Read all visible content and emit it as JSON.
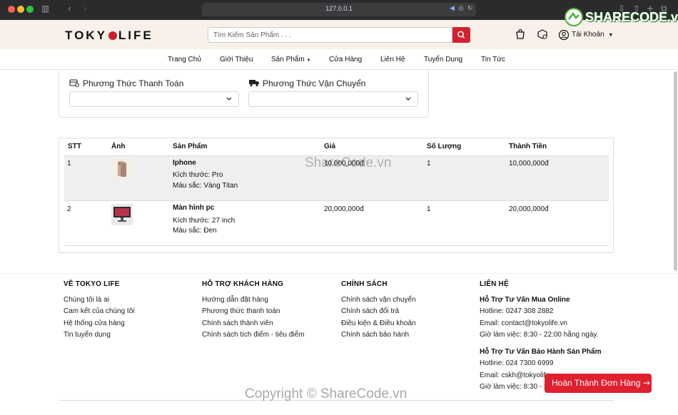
{
  "browser": {
    "url": "127.0.0.1"
  },
  "header": {
    "logo_left": "TOKY",
    "logo_right": "LIFE",
    "search_placeholder": "Tìm Kiếm Sản Phẩm . . .",
    "account_label": "Tài Khoản"
  },
  "nav": [
    "Trang Chủ",
    "Giới Thiệu",
    "Sản Phẩm",
    "Cửa Hàng",
    "Liên Hệ",
    "Tuyển Dụng",
    "Tin Tức"
  ],
  "checkout": {
    "payment_title": "Phương Thức Thanh Toán",
    "shipping_title": "Phương Thức Vận Chuyển"
  },
  "table": {
    "headers": [
      "STT",
      "Ảnh",
      "Sản Phẩm",
      "Giá",
      "Số Lượng",
      "Thành Tiền"
    ],
    "rows": [
      {
        "stt": "1",
        "name": "Iphone",
        "size": "Kích thước: Pro",
        "color": "Màu sắc: Vàng Titan",
        "price": "10,000,000đ",
        "qty": "1",
        "total": "10,000,000đ"
      },
      {
        "stt": "2",
        "name": "Màn hình pc",
        "size": "Kích thước: 27 inch",
        "color": "Màu sắc: Đen",
        "price": "20,000,000đ",
        "qty": "1",
        "total": "20,000,000đ"
      }
    ]
  },
  "footer": {
    "col1": {
      "title": "VỀ TOKYO LIFE",
      "links": [
        "Chúng tôi là ai",
        "Cam kết của chúng tôi",
        "Hệ thống cửa hàng",
        "Tin tuyển dụng"
      ]
    },
    "col2": {
      "title": "HỖ TRỢ KHÁCH HÀNG",
      "links": [
        "Hướng dẫn đặt hàng",
        "Phương thức thanh toán",
        "Chính sách thành viên",
        "Chính sách tích điểm - tiêu điểm"
      ]
    },
    "col3": {
      "title": "CHÍNH SÁCH",
      "links": [
        "Chính sách vận chuyển",
        "Chính sách đổi trả",
        "Điều kiện & Điều khoản",
        "Chính sách bảo hành"
      ]
    },
    "col4": {
      "title": "LIÊN HỆ",
      "sub1": "Hỗ Trợ Tư Vấn Mua Online",
      "lines1": [
        "Hotline: 0247 308 2882",
        "Email: contact@tokyolife.vn",
        "Giờ làm việc: 8:30 - 22:00 hằng ngày."
      ],
      "sub2": "Hỗ Trợ Tư Vấn Bảo Hành Sản Phẩm",
      "lines2": [
        "Hotline: 024 7300 6999",
        "Email: cskh@tokyolife",
        "Giờ làm việc: 8:30 - 2"
      ]
    }
  },
  "finish_button": "Hoàn Thành Đơn Hàng",
  "watermarks": {
    "corner": "SHARECODE.vn",
    "center": "ShareCode.vn",
    "bottom": "Copyright © ShareCode.vn"
  }
}
